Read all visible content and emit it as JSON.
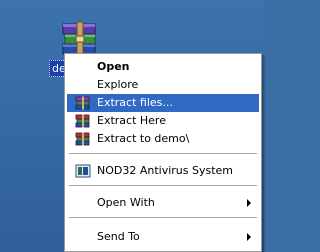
{
  "desktop": {
    "file_label": "demo",
    "file_icon": "winrar-archive-icon"
  },
  "context_menu": {
    "items": [
      {
        "label": "Open",
        "bold": true,
        "icon": ""
      },
      {
        "label": "Explore",
        "icon": ""
      },
      {
        "label": "Extract files...",
        "icon": "winrar-extract-icon",
        "selected": true
      },
      {
        "label": "Extract Here",
        "icon": "winrar-extract-icon"
      },
      {
        "label": "Extract to demo\\",
        "icon": "winrar-extract-icon"
      },
      {
        "label": "NOD32 Antivirus System",
        "icon": "nod32-icon"
      },
      {
        "label": "Open With",
        "submenu": true
      },
      {
        "label": "Send To",
        "submenu": true
      }
    ]
  },
  "colors": {
    "desktop_bg": "#3a6ea5",
    "selection": "#316ac5",
    "label_highlight": "#1c3fa8"
  }
}
